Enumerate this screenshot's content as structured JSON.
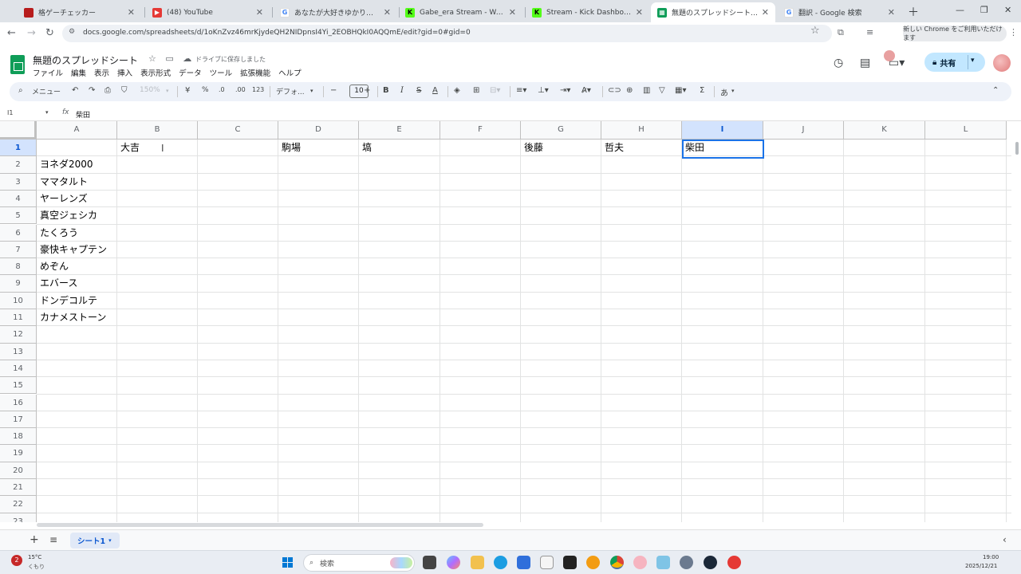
{
  "browser": {
    "tabs": [
      {
        "label": "格ゲーチェッカー",
        "active": false,
        "favicon_color": "#b71c1c"
      },
      {
        "label": "(48) YouTube",
        "active": false,
        "favicon_color": "#e53935"
      },
      {
        "label": "あなたが大好きゆかりちゃんーばん…",
        "active": false,
        "favicon_color": "#ffffff"
      },
      {
        "label": "Gabe_era Stream - Watch Live",
        "active": false,
        "favicon_color": "#53fc18"
      },
      {
        "label": "Stream - Kick Dashboard",
        "active": false,
        "favicon_color": "#53fc18"
      },
      {
        "label": "無題のスプレッドシート - Google ス",
        "active": true,
        "favicon_color": "#0f9d58"
      },
      {
        "label": "翻訳 - Google 検索",
        "active": false,
        "favicon_color": "#ffffff"
      }
    ],
    "url": "docs.google.com/spreadsheets/d/1oKnZvz46mrKjydeQH2NIDpnsI4Yi_2EOBHQkI0AQQmE/edit?gid=0#gid=0",
    "chrome_pill": "新しい Chrome をご利用いただけます"
  },
  "sheets": {
    "title": "無題のスプレッドシート",
    "saved_status": "ドライブに保存しました",
    "menu": [
      "ファイル",
      "編集",
      "表示",
      "挿入",
      "表示形式",
      "データ",
      "ツール",
      "拡張機能",
      "ヘルプ"
    ],
    "share_label": "共有",
    "toolbar": {
      "search_menu": "メニュー",
      "zoom": "150%",
      "currency": "¥",
      "percent": "%",
      "dec_decrease": ".0",
      "dec_increase": ".00",
      "number_format": "123",
      "font": "デフォ...",
      "font_size": "10",
      "ime": "あ"
    },
    "namebox": "I1",
    "formula_value": "柴田",
    "columns": [
      "A",
      "B",
      "C",
      "D",
      "E",
      "F",
      "G",
      "H",
      "I",
      "J",
      "K",
      "L"
    ],
    "selected_column": "I",
    "rows": [
      1,
      2,
      3,
      4,
      5,
      6,
      7,
      8,
      9,
      10,
      11,
      12,
      13,
      14,
      15,
      16,
      17,
      18,
      19,
      20,
      21,
      22,
      23
    ],
    "selected_row": 1,
    "row1": {
      "B": "大吉",
      "D": "駒場",
      "E": "塙",
      "G": "後藤",
      "H": "哲夫",
      "I": "柴田"
    },
    "colA": [
      "ヨネダ2000",
      "ママタルト",
      "ヤーレンズ",
      "真空ジェシカ",
      "たくろう",
      "豪快キャプテン",
      "めぞん",
      "エバース",
      "ドンデコルテ",
      "カナメストーン"
    ],
    "sheet_tab": "シート1"
  },
  "taskbar": {
    "weather_temp": "15°C",
    "weather_desc": "くもり",
    "weather_badge": "2",
    "search_placeholder": "検索",
    "time": "19:00",
    "date": "2025/12/21"
  }
}
